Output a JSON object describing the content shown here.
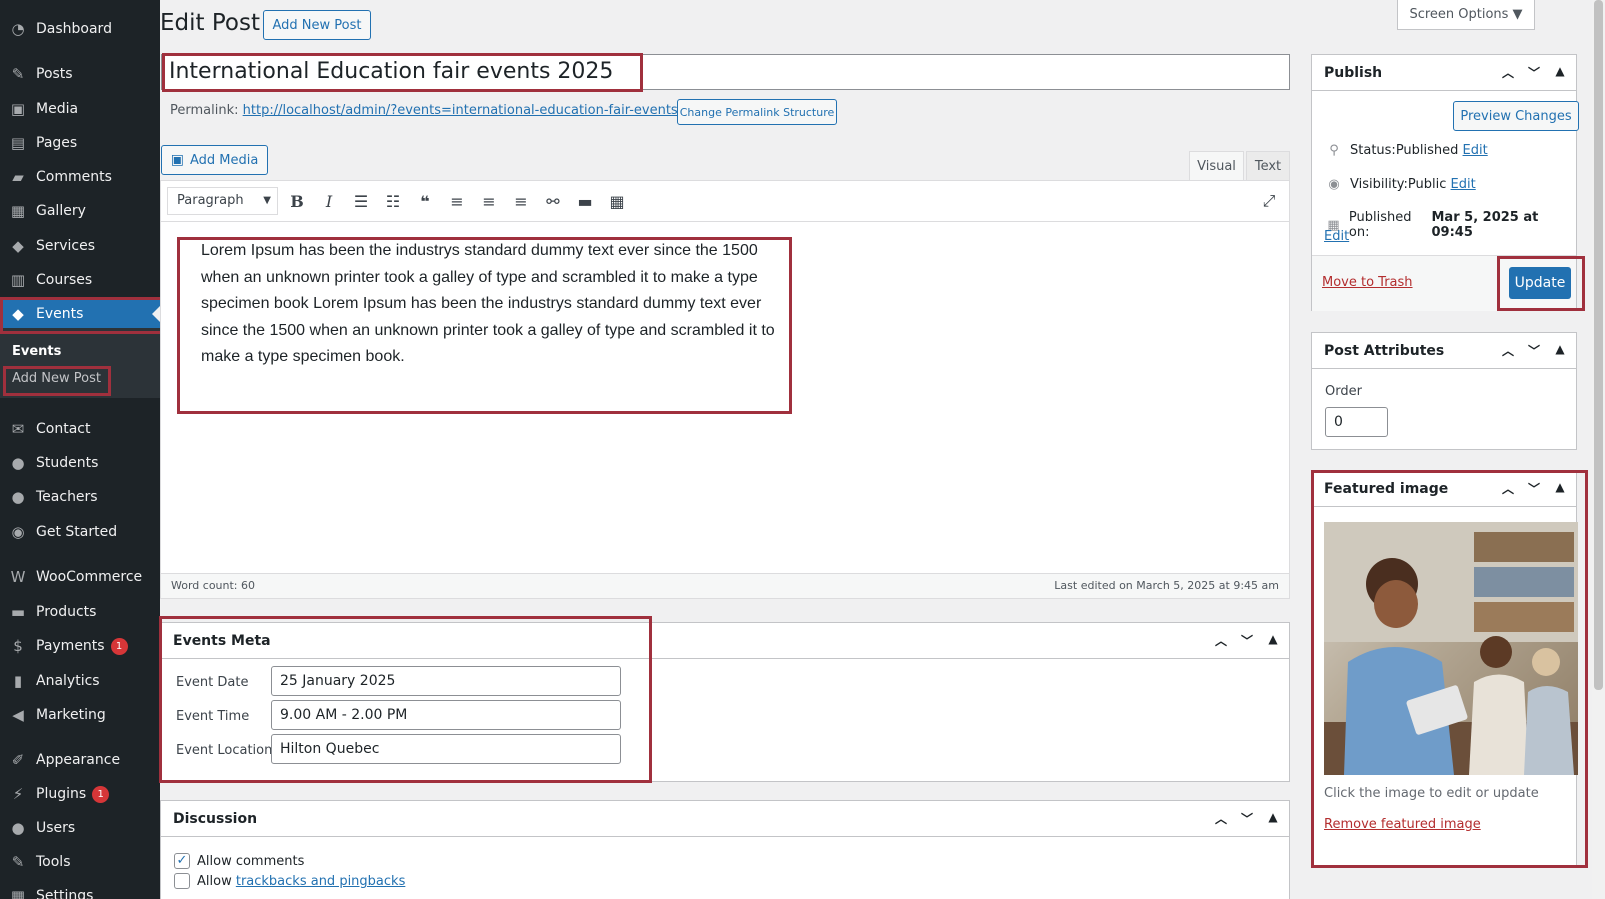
{
  "sidebar": {
    "items": [
      {
        "label": "Dashboard",
        "icon": "dashboard-icon",
        "glyph": "◔"
      },
      {
        "label": "Posts",
        "icon": "pin-icon",
        "glyph": "✎"
      },
      {
        "label": "Media",
        "icon": "media-icon",
        "glyph": "▣"
      },
      {
        "label": "Pages",
        "icon": "page-icon",
        "glyph": "▤"
      },
      {
        "label": "Comments",
        "icon": "comment-icon",
        "glyph": "▰"
      },
      {
        "label": "Gallery",
        "icon": "gallery-icon",
        "glyph": "▦"
      },
      {
        "label": "Services",
        "icon": "tag-icon",
        "glyph": "◆"
      },
      {
        "label": "Courses",
        "icon": "courses-icon",
        "glyph": "▥"
      },
      {
        "label": "Events",
        "icon": "tag-icon",
        "glyph": "◆"
      },
      {
        "label": "Contact",
        "icon": "envelope-icon",
        "glyph": "✉"
      },
      {
        "label": "Students",
        "icon": "user-icon",
        "glyph": "●"
      },
      {
        "label": "Teachers",
        "icon": "user-icon",
        "glyph": "●"
      },
      {
        "label": "Get Started",
        "icon": "globe-icon",
        "glyph": "◉"
      },
      {
        "label": "WooCommerce",
        "icon": "woocommerce-icon",
        "glyph": "W"
      },
      {
        "label": "Products",
        "icon": "products-icon",
        "glyph": "▬"
      },
      {
        "label": "Payments",
        "icon": "payments-icon",
        "glyph": "$",
        "badge": "1"
      },
      {
        "label": "Analytics",
        "icon": "bar-chart-icon",
        "glyph": "▮"
      },
      {
        "label": "Marketing",
        "icon": "megaphone-icon",
        "glyph": "◀"
      },
      {
        "label": "Appearance",
        "icon": "brush-icon",
        "glyph": "✐"
      },
      {
        "label": "Plugins",
        "icon": "plug-icon",
        "glyph": "⚡",
        "badge": "1"
      },
      {
        "label": "Users",
        "icon": "user-icon",
        "glyph": "●"
      },
      {
        "label": "Tools",
        "icon": "wrench-icon",
        "glyph": "✎"
      },
      {
        "label": "Settings",
        "icon": "settings-icon",
        "glyph": "▦"
      }
    ],
    "submenu": {
      "title": "Events",
      "add_new": "Add New Post"
    }
  },
  "header": {
    "title": "Edit Post",
    "add_new": "Add New Post",
    "screen_options": "Screen Options ▼"
  },
  "post": {
    "title": "International Education fair events 2025",
    "permalink_label": "Permalink:",
    "permalink_url": "http://localhost/admin/?events=international-education-fair-events-2025",
    "permalink_button": "Change Permalink Structure",
    "add_media": "Add Media",
    "tab_visual": "Visual",
    "tab_text": "Text",
    "format": "Paragraph",
    "content_lines": [
      "Lorem Ipsum has been the industrys standard dummy text ever since the 1500",
      "when an unknown printer took a galley of type and scrambled it to make a type",
      "specimen book Lorem Ipsum has been the industrys standard dummy text ever",
      "since the 1500 when an unknown printer took a galley of type and scrambled it to",
      "make a type specimen book."
    ],
    "word_count": "Word count: 60",
    "last_edited": "Last edited on March 5, 2025 at 9:45 am"
  },
  "events_meta": {
    "title": "Events Meta",
    "date_label": "Event Date",
    "date_value": "25 January 2025",
    "time_label": "Event Time",
    "time_value": "9.00 AM - 2.00 PM",
    "location_label": "Event Location",
    "location_value": "Hilton Quebec"
  },
  "discussion": {
    "title": "Discussion",
    "allow_comments": "Allow comments",
    "allow_trackbacks_prefix": "Allow ",
    "allow_trackbacks_link": "trackbacks and pingbacks",
    "allow_comments_checked": true,
    "allow_trackbacks_checked": false
  },
  "publish": {
    "title": "Publish",
    "preview": "Preview Changes",
    "status_label": "Status: ",
    "status_value": "Published",
    "visibility_label": "Visibility: ",
    "visibility_value": "Public",
    "published_label": "Published on: ",
    "published_value": "Mar 5, 2025 at 09:45",
    "edit": "Edit",
    "trash": "Move to Trash",
    "update": "Update"
  },
  "attributes": {
    "title": "Post Attributes",
    "order_label": "Order",
    "order_value": "0"
  },
  "featured": {
    "title": "Featured image",
    "hint": "Click the image to edit or update",
    "remove": "Remove featured image"
  },
  "colors": {
    "sidebar_bg": "#1d2327",
    "accent": "#2271b1",
    "highlight": "#a0303d"
  }
}
